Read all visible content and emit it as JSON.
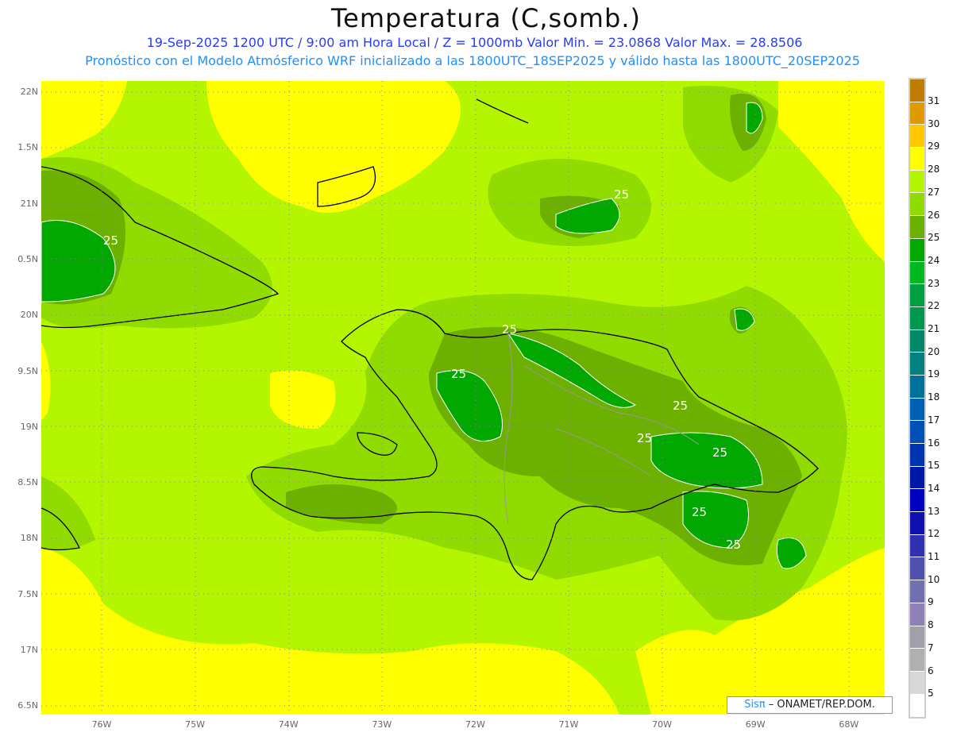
{
  "header": {
    "title": "Temperatura (C,somb.)",
    "subtitle1": "19-Sep-2025  1200 UTC / 9:00 am Hora Local / Z = 1000mb   Valor Min. = 23.0868  Valor Max. = 28.8506",
    "subtitle2": "Pronóstico con el Modelo Atmósferico WRF inicializado a las 1800UTC_18SEP2025 y válido hasta las  1800UTC_20SEP2025"
  },
  "axes": {
    "lat_labels": [
      "22N",
      "1.5N",
      "21N",
      "0.5N",
      "20N",
      "9.5N",
      "19N",
      "8.5N",
      "18N",
      "7.5N",
      "17N",
      "6.5N"
    ],
    "lon_labels": [
      "76W",
      "75W",
      "74W",
      "73W",
      "72W",
      "71W",
      "70W",
      "69W",
      "68W"
    ]
  },
  "contour_labels": [
    "25",
    "25",
    "25",
    "25",
    "25",
    "25",
    "25",
    "25",
    "25"
  ],
  "colorbar": {
    "labels": [
      "31",
      "30",
      "29",
      "28",
      "27",
      "26",
      "25",
      "24",
      "23",
      "22",
      "21",
      "20",
      "19",
      "18",
      "17",
      "16",
      "15",
      "14",
      "13",
      "12",
      "11",
      "10",
      "9",
      "8",
      "7",
      "6",
      "5"
    ],
    "colors": [
      "#c07c00",
      "#e09a00",
      "#ffc800",
      "#ffff00",
      "#b4f500",
      "#90dc00",
      "#6cb000",
      "#00a800",
      "#00b820",
      "#00a040",
      "#009850",
      "#008868",
      "#008080",
      "#00709c",
      "#0060b4",
      "#0050b8",
      "#0034b0",
      "#0018a8",
      "#0000c0",
      "#1010b0",
      "#3030b0",
      "#5050b0",
      "#7070b0",
      "#9080b8",
      "#a0a0a8",
      "#b0b0b0",
      "#d8d8d8",
      "#ffffff"
    ]
  },
  "logo": {
    "brand": "Sisπ",
    "text": " – ONAMET/REP.DOM."
  }
}
